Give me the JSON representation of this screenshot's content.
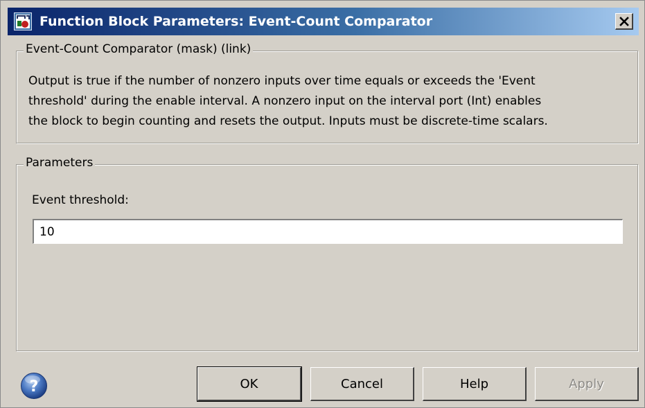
{
  "window": {
    "title": "Function Block Parameters: Event-Count Comparator",
    "close_icon": "close-x-icon",
    "app_icon": "simulink-block-icon"
  },
  "description_group": {
    "legend": "Event-Count Comparator (mask) (link)",
    "lines": [
      "Output is true if the number of nonzero inputs over time equals or exceeds the 'Event",
      "threshold' during the enable interval.   A nonzero input on the interval port (Int) enables",
      "the block to begin counting and resets the output.  Inputs must be discrete-time scalars."
    ]
  },
  "parameters_group": {
    "legend": "Parameters",
    "event_threshold_label": "Event threshold:",
    "event_threshold_value": "10"
  },
  "footer": {
    "help_icon": "question-mark-icon",
    "ok_label": "OK",
    "cancel_label": "Cancel",
    "help_label": "Help",
    "apply_label": "Apply",
    "apply_enabled": false
  }
}
